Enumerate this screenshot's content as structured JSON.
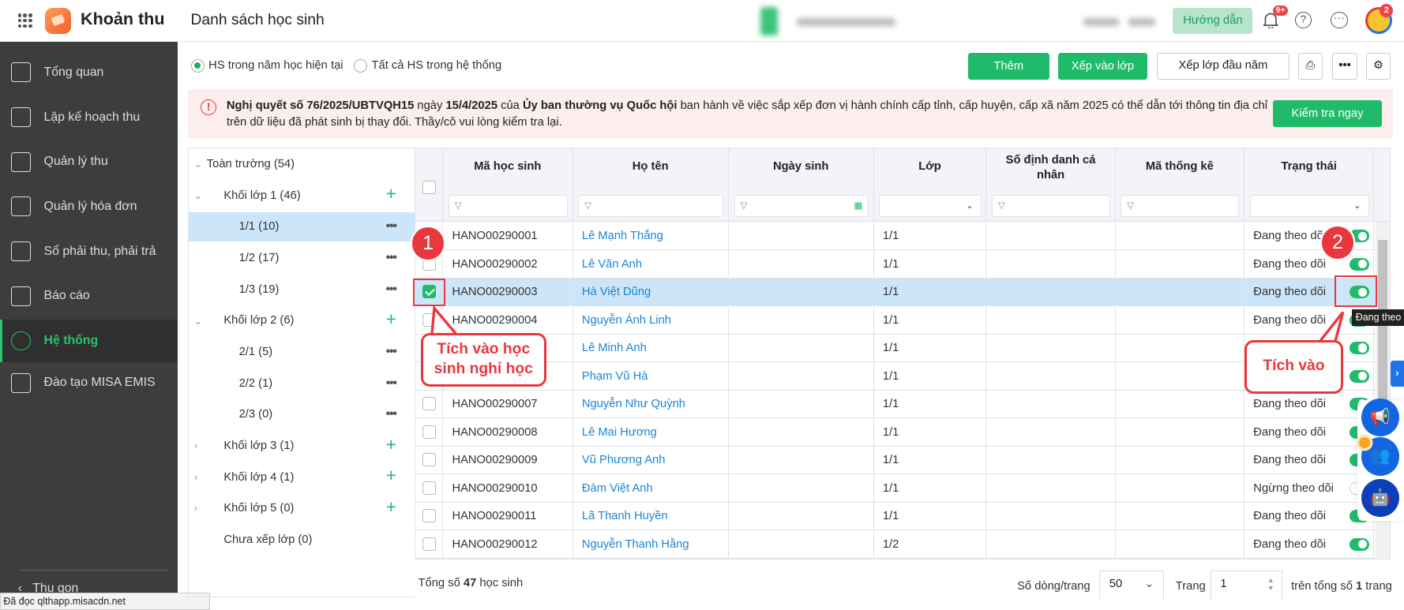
{
  "header": {
    "app_name": "Khoản thu",
    "page_title": "Danh sách học sinh",
    "guide_button": "Hướng dẫn",
    "notification_badge": "9+",
    "avatar_badge": "2"
  },
  "sidebar": {
    "items": [
      {
        "label": "Tổng quan",
        "icon": "chart-bars-icon"
      },
      {
        "label": "Lập kế hoạch thu",
        "icon": "calendar-dollar-icon"
      },
      {
        "label": "Quản lý thu",
        "icon": "hand-money-icon"
      },
      {
        "label": "Quản lý hóa đơn",
        "icon": "invoice-icon"
      },
      {
        "label": "Sổ phải thu, phải trả",
        "icon": "ledger-icon"
      },
      {
        "label": "Báo cáo",
        "icon": "pie-chart-icon"
      },
      {
        "label": "Hệ thống",
        "icon": "gear-icon"
      },
      {
        "label": "Đào tạo MISA EMIS",
        "icon": "book-icon"
      }
    ],
    "collapse_label": "Thu gọn"
  },
  "status_bar": "Đã đọc qlthapp.misacdn.net",
  "filters": {
    "radio_current": "HS trong năm học hiện tại",
    "radio_all": "Tất cả HS trong hệ thống"
  },
  "toolbar": {
    "add": "Thêm",
    "assign_class": "Xếp vào lớp",
    "assign_start_year": "Xếp lớp đầu năm"
  },
  "alert": {
    "b1": "Nghị quyết số 76/2025/UBTVQH15",
    "t1": " ngày ",
    "b2": "15/4/2025",
    "t2": " của ",
    "b3": "Ủy ban thường vụ Quốc hội",
    "t3": " ban hành về việc sắp xếp đơn vị hành chính cấp tỉnh, cấp huyện, cấp xã năm 2025 có thể dẫn tới thông tin địa chỉ trên dữ liệu đã phát sinh bị thay đổi. Thầy/cô vui lòng kiểm tra lại.",
    "check_button": "Kiểm tra ngay"
  },
  "tree": [
    {
      "label": "Toàn trường (54)",
      "level": 0,
      "chev": "v",
      "action": ""
    },
    {
      "label": "Khối lớp 1 (46)",
      "level": 1,
      "chev": "v",
      "action": "+"
    },
    {
      "label": "1/1 (10)",
      "level": 2,
      "chev": "",
      "action": "•••",
      "selected": true
    },
    {
      "label": "1/2 (17)",
      "level": 2,
      "chev": "",
      "action": "•••"
    },
    {
      "label": "1/3 (19)",
      "level": 2,
      "chev": "",
      "action": "•••"
    },
    {
      "label": "Khối lớp 2 (6)",
      "level": 1,
      "chev": "v",
      "action": "+"
    },
    {
      "label": "2/1 (5)",
      "level": 2,
      "chev": "",
      "action": "•••"
    },
    {
      "label": "2/2 (1)",
      "level": 2,
      "chev": "",
      "action": "•••"
    },
    {
      "label": "2/3 (0)",
      "level": 2,
      "chev": "",
      "action": "•••"
    },
    {
      "label": "Khối lớp 3 (1)",
      "level": 1,
      "chev": ">",
      "action": "+"
    },
    {
      "label": "Khối lớp 4 (1)",
      "level": 1,
      "chev": ">",
      "action": "+"
    },
    {
      "label": "Khối lớp 5 (0)",
      "level": 1,
      "chev": ">",
      "action": "+"
    },
    {
      "label": "Chưa xếp lớp (0)",
      "level": 1,
      "chev": "",
      "action": ""
    }
  ],
  "table": {
    "columns": [
      "Mã học sinh",
      "Họ tên",
      "Ngày sinh",
      "Lớp",
      "Số định danh cá nhân",
      "Mã thống kê",
      "Trạng thái"
    ],
    "rows": [
      {
        "code": "HANO00290001",
        "name": "Lê Mạnh Thắng",
        "dob": "",
        "class": "1/1",
        "id": "",
        "stat": "",
        "status": "Đang theo dõi",
        "on": true,
        "checked": false
      },
      {
        "code": "HANO00290002",
        "name": "Lê Văn Anh",
        "dob": "",
        "class": "1/1",
        "id": "",
        "stat": "",
        "status": "Đang theo dõi",
        "on": true,
        "checked": false
      },
      {
        "code": "HANO00290003",
        "name": "Hà Việt Dũng",
        "dob": "",
        "class": "1/1",
        "id": "",
        "stat": "",
        "status": "Đang theo dõi",
        "on": true,
        "checked": true
      },
      {
        "code": "HANO00290004",
        "name": "Nguyễn Ánh Linh",
        "dob": "",
        "class": "1/1",
        "id": "",
        "stat": "",
        "status": "Đang theo dõi",
        "on": true,
        "checked": false
      },
      {
        "code": "HANO00290005",
        "name": "Lê Minh Anh",
        "dob": "",
        "class": "1/1",
        "id": "",
        "stat": "",
        "status": "",
        "on": true,
        "checked": false
      },
      {
        "code": "HANO00290006",
        "name": "Phạm Vũ Hà",
        "dob": "",
        "class": "1/1",
        "id": "",
        "stat": "",
        "status": "",
        "on": true,
        "checked": false
      },
      {
        "code": "HANO00290007",
        "name": "Nguyễn Như Quỳnh",
        "dob": "",
        "class": "1/1",
        "id": "",
        "stat": "",
        "status": "Đang theo dõi",
        "on": true,
        "checked": false
      },
      {
        "code": "HANO00290008",
        "name": "Lê Mai Hương",
        "dob": "",
        "class": "1/1",
        "id": "",
        "stat": "",
        "status": "Đang theo dõi",
        "on": true,
        "checked": false
      },
      {
        "code": "HANO00290009",
        "name": "Vũ Phương Anh",
        "dob": "",
        "class": "1/1",
        "id": "",
        "stat": "",
        "status": "Đang theo dõi",
        "on": true,
        "checked": false
      },
      {
        "code": "HANO00290010",
        "name": "Đàm Việt Anh",
        "dob": "",
        "class": "1/1",
        "id": "",
        "stat": "",
        "status": "Ngừng theo dõi",
        "on": false,
        "checked": false
      },
      {
        "code": "HANO00290011",
        "name": "Lã Thanh Huyền",
        "dob": "",
        "class": "1/1",
        "id": "",
        "stat": "",
        "status": "Đang theo dõi",
        "on": true,
        "checked": false
      },
      {
        "code": "HANO00290012",
        "name": "Nguyễn Thanh Hằng",
        "dob": "",
        "class": "1/2",
        "id": "",
        "stat": "",
        "status": "Đang theo dõi",
        "on": true,
        "checked": false
      }
    ]
  },
  "footer": {
    "total_prefix": "Tổng số ",
    "total": "47",
    "total_suffix": " học sinh",
    "rows_per_page_label": "Số dòng/trang",
    "rows_per_page": "50",
    "page_label": "Trang",
    "page": "1",
    "of_prefix": "trên tổng số ",
    "total_pages": "1",
    "of_suffix": " trang"
  },
  "annotations": {
    "step1": "1",
    "step1_callout": "Tích vào học sinh nghỉ học",
    "step2": "2",
    "step2_callout": "Tích vào",
    "tooltip": "Đang theo dõi"
  },
  "colors": {
    "accent": "#1fbb6a",
    "sidebar": "#3d3d3d",
    "annotation": "#e8383d",
    "link": "#1a85d6"
  }
}
